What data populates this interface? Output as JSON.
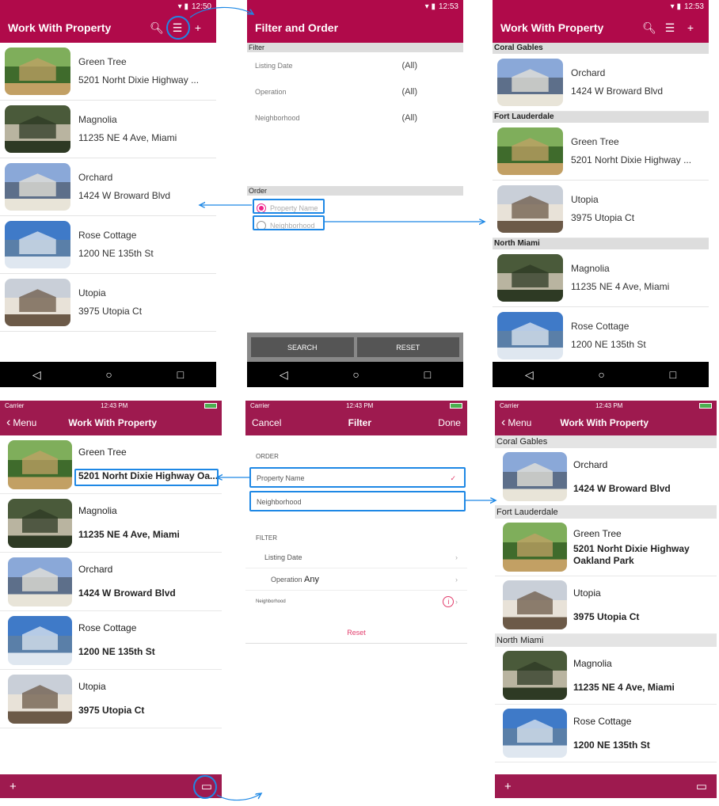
{
  "colors": {
    "android_primary": "#b00a4a",
    "ios_primary": "#9e1a4f",
    "highlight": "#1e88e5"
  },
  "android": {
    "time1": "12:50",
    "time2": "12:53",
    "list_title": "Work With Property",
    "icons": [
      "search-icon",
      "filter-icon",
      "add-icon"
    ],
    "items": [
      {
        "name": "Green Tree",
        "addr": "5201 Norht Dixie Highway ...",
        "img": "green-tree"
      },
      {
        "name": "Magnolia",
        "addr": "11235 NE 4 Ave, Miami",
        "img": "magnolia"
      },
      {
        "name": "Orchard",
        "addr": "1424 W Broward Blvd",
        "img": "orchard"
      },
      {
        "name": "Rose Cottage",
        "addr": "1200 NE 135th St",
        "img": "rose"
      },
      {
        "name": "Utopia",
        "addr": "3975 Utopia Ct",
        "img": "utopia"
      }
    ],
    "filter": {
      "title": "Filter and Order",
      "filter_header": "Filter",
      "fields": [
        {
          "label": "Listing Date",
          "value": "(All)"
        },
        {
          "label": "Operation",
          "value": "(All)"
        },
        {
          "label": "Neighborhood",
          "value": "(All)"
        }
      ],
      "order_header": "Order",
      "order_options": [
        "Property Name",
        "Neighborhood"
      ],
      "search": "SEARCH",
      "reset": "RESET"
    },
    "grouped": [
      {
        "group": "Coral Gables",
        "items": [
          {
            "name": "Orchard",
            "addr": "1424 W Broward Blvd",
            "img": "orchard"
          }
        ]
      },
      {
        "group": "Fort Lauderdale",
        "items": [
          {
            "name": "Green Tree",
            "addr": "5201 Norht Dixie Highway ...",
            "img": "green-tree"
          },
          {
            "name": "Utopia",
            "addr": "3975 Utopia Ct",
            "img": "utopia"
          }
        ]
      },
      {
        "group": "North Miami",
        "items": [
          {
            "name": "Magnolia",
            "addr": "11235 NE 4 Ave, Miami",
            "img": "magnolia"
          },
          {
            "name": "Rose Cottage",
            "addr": "1200 NE 135th St",
            "img": "rose"
          }
        ]
      }
    ]
  },
  "ios": {
    "carrier": "Carrier",
    "time": "12:43 PM",
    "back": "Menu",
    "list_title": "Work With Property",
    "items": [
      {
        "name": "Green Tree",
        "addr": "5201 Norht Dixie Highway Oa...",
        "img": "green-tree"
      },
      {
        "name": "Magnolia",
        "addr": "11235 NE 4 Ave, Miami",
        "img": "magnolia"
      },
      {
        "name": "Orchard",
        "addr": "1424 W Broward Blvd",
        "img": "orchard"
      },
      {
        "name": "Rose Cottage",
        "addr": "1200 NE 135th St",
        "img": "rose"
      },
      {
        "name": "Utopia",
        "addr": "3975 Utopia Ct",
        "img": "utopia"
      }
    ],
    "filter": {
      "cancel": "Cancel",
      "title": "Filter",
      "done": "Done",
      "order_header": "ORDER",
      "order_options": [
        "Property Name",
        "Neighborhood"
      ],
      "filter_header": "FILTER",
      "listing_date": "Listing Date",
      "operation": "Operation",
      "operation_value": "Any",
      "neighborhood": "Neighborhood",
      "reset": "Reset"
    },
    "grouped": [
      {
        "group": "Coral Gables",
        "items": [
          {
            "name": "Orchard",
            "addr": "1424 W Broward Blvd",
            "img": "orchard"
          }
        ]
      },
      {
        "group": "Fort Lauderdale",
        "items": [
          {
            "name": "Green Tree",
            "addr": "5201 Norht Dixie Highway Oakland Park",
            "img": "green-tree"
          },
          {
            "name": "Utopia",
            "addr": "3975 Utopia Ct",
            "img": "utopia"
          }
        ]
      },
      {
        "group": "North Miami",
        "items": [
          {
            "name": "Magnolia",
            "addr": "11235 NE 4 Ave, Miami",
            "img": "magnolia"
          },
          {
            "name": "Rose Cottage",
            "addr": "1200 NE 135th St",
            "img": "rose"
          }
        ]
      }
    ]
  }
}
